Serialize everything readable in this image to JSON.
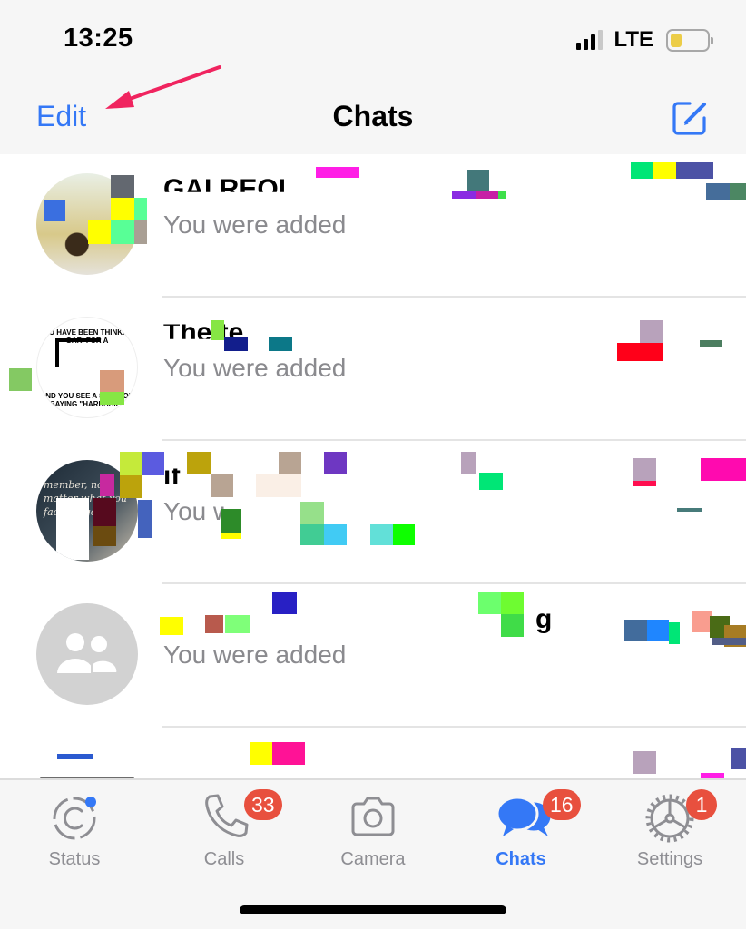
{
  "status_bar": {
    "time": "13:25",
    "network": "LTE",
    "signal_bars": 3,
    "signal_bars_total": 4,
    "battery_level": 0.25,
    "battery_color": "#eccd48"
  },
  "nav": {
    "edit_label": "Edit",
    "title": "Chats",
    "compose_icon": "compose-icon",
    "annotation": "arrow pointing to Edit",
    "accent": "#3478f6"
  },
  "chats": [
    {
      "name": "GAI        REOI",
      "time": "",
      "preview": "You were added",
      "avatar": "photo",
      "redacted": true
    },
    {
      "name": "The        te",
      "time": "",
      "preview": "You were added",
      "avatar": "photo",
      "redacted": true
    },
    {
      "name": "                        if",
      "time": "",
      "preview": "You were added",
      "avatar": "photo",
      "redacted": true
    },
    {
      "name": "",
      "time": "",
      "preview": "You were added",
      "avatar": "group-placeholder",
      "redacted": true
    },
    {
      "name": "",
      "time": "",
      "preview": "",
      "avatar": "photo",
      "redacted": true
    }
  ],
  "avatar_text": {
    "a2_top": "YOU HAVE BEEN THINKING GARI FOR A",
    "a2_bottom": "AND YOU SEE A SENATOR SAYING \"HARDSHIP\"",
    "a3": "member, no matter what you face let go Ha"
  },
  "tabs": [
    {
      "label": "Status",
      "icon": "status-icon",
      "badge": null,
      "active": false,
      "has_dot": true
    },
    {
      "label": "Calls",
      "icon": "phone-icon",
      "badge": "33",
      "active": false
    },
    {
      "label": "Camera",
      "icon": "camera-icon",
      "badge": null,
      "active": false
    },
    {
      "label": "Chats",
      "icon": "chats-icon",
      "badge": "16",
      "active": true
    },
    {
      "label": "Settings",
      "icon": "gear-icon",
      "badge": "1",
      "active": false
    }
  ],
  "colors": {
    "accent": "#3478f6",
    "badge": "#e8503e",
    "secondary_text": "#8a8a8e",
    "tab_inactive": "#8e8e93",
    "annotation_arrow": "#f0245f"
  }
}
